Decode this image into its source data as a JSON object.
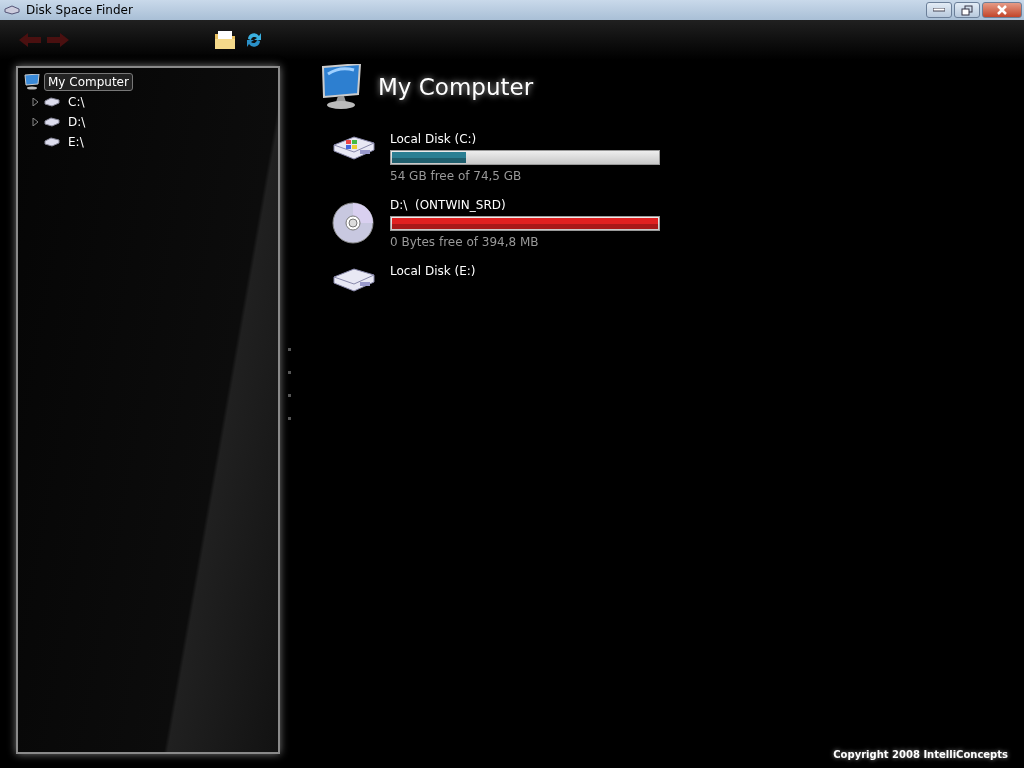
{
  "window": {
    "title": "Disk Space Finder"
  },
  "tree": {
    "label": "My Computer",
    "selected": true,
    "children": [
      {
        "label": "C:\\",
        "expandable": true,
        "selected": false
      },
      {
        "label": "D:\\",
        "expandable": true,
        "selected": false
      },
      {
        "label": "E:\\",
        "expandable": false,
        "selected": false
      }
    ]
  },
  "heading": "My Computer",
  "drives": [
    {
      "kind": "system",
      "name": "Local Disk (C:)",
      "bar": {
        "level": 0.28,
        "color": "#2b7f93"
      },
      "free": "54 GB free of 74,5 GB"
    },
    {
      "kind": "cd",
      "name": "D:\\  (ONTWIN_SRD)",
      "bar": {
        "level": 1,
        "color": "#e02020"
      },
      "free": "0 Bytes free of 394,8 MB"
    },
    {
      "kind": "disk",
      "name": "Local Disk (E:)"
    }
  ],
  "footer": "Copyright 2008 IntelliConcepts"
}
